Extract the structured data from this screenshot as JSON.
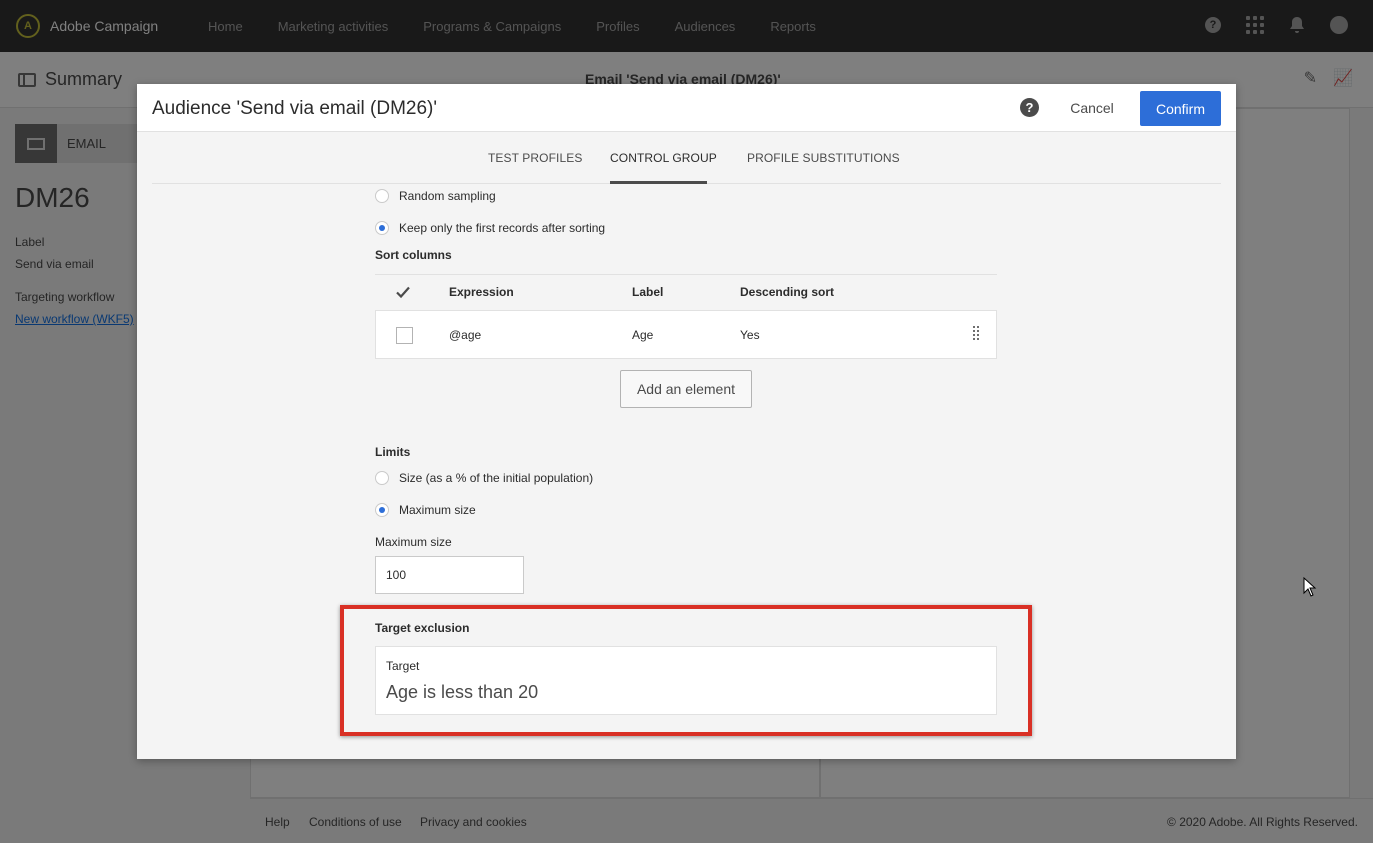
{
  "app": {
    "name": "Adobe Campaign",
    "logo_glyph": "A"
  },
  "topnav": {
    "items": [
      "Home",
      "Marketing activities",
      "Programs & Campaigns",
      "Profiles",
      "Audiences",
      "Reports"
    ],
    "help_glyph": "?",
    "icons": [
      "help-icon",
      "apps-grid-icon",
      "bell-icon",
      "user-avatar-icon"
    ]
  },
  "subheader": {
    "title": "Summary",
    "delivery": "Email 'Send via email (DM26)'"
  },
  "left_panel": {
    "card_label": "EMAIL",
    "code": "DM26",
    "label_heading": "Label",
    "label_value": "Send via email",
    "workflow_heading": "Targeting workflow",
    "workflow_link": "New workflow (WKF5)"
  },
  "footer": {
    "help": "Help",
    "conditions": "Conditions of use",
    "privacy": "Privacy and cookies",
    "copyright": "© 2020 Adobe. All Rights Reserved."
  },
  "dialog": {
    "title": "Audience 'Send via email (DM26)'",
    "help_glyph": "?",
    "cancel_label": "Cancel",
    "confirm_label": "Confirm",
    "tabs": [
      {
        "label": "TEST PROFILES",
        "active": false
      },
      {
        "label": "CONTROL GROUP",
        "active": true
      },
      {
        "label": "PROFILE SUBSTITUTIONS",
        "active": false
      }
    ],
    "selection": {
      "options": [
        {
          "label": "Random sampling",
          "selected": false
        },
        {
          "label": "Keep only the first records after sorting",
          "selected": true
        }
      ]
    },
    "sort_columns": {
      "heading": "Sort columns",
      "columns": [
        "Expression",
        "Label",
        "Descending sort"
      ],
      "rows": [
        {
          "expression": "@age",
          "label": "Age",
          "descending": "Yes"
        }
      ],
      "add_label": "Add an element"
    },
    "limits": {
      "heading": "Limits",
      "options": [
        {
          "label": "Size (as a % of the initial population)",
          "selected": false
        },
        {
          "label": "Maximum size",
          "selected": true
        }
      ],
      "max_size_label": "Maximum size",
      "max_size_value": "100"
    },
    "target_exclusion": {
      "heading": "Target exclusion",
      "target_label": "Target",
      "target_value": "Age is less than 20"
    }
  },
  "colors": {
    "topnav_bg": "#323232",
    "accent_blue": "#2d6ed8",
    "highlight_red": "#d93025"
  }
}
